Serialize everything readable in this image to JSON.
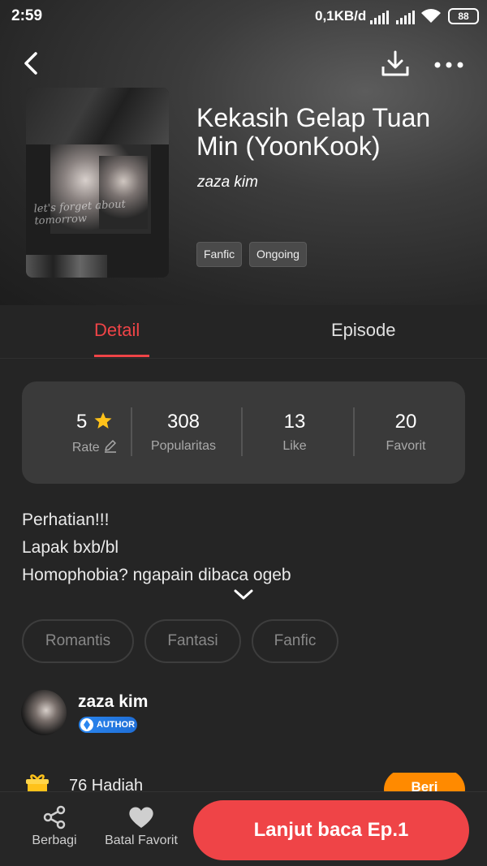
{
  "status_bar": {
    "time": "2:59",
    "network_speed": "0,1KB/d",
    "battery": "88"
  },
  "story": {
    "title": "Kekasih Gelap Tuan Min (YoonKook)",
    "author": "zaza kim",
    "cover_script": "let's forget about tomorrow",
    "tags": [
      "Fanfic",
      "Ongoing"
    ]
  },
  "tabs": {
    "detail": "Detail",
    "episode": "Episode"
  },
  "stats": {
    "rate_value": "5",
    "rate_label": "Rate",
    "popularity_value": "308",
    "popularity_label": "Popularitas",
    "like_value": "13",
    "like_label": "Like",
    "favorite_value": "20",
    "favorite_label": "Favorit"
  },
  "description": [
    "Perhatian!!!",
    "Lapak bxb/bl",
    "Homophobia? ngapain dibaca ogeb"
  ],
  "genres": [
    "Romantis",
    "Fantasi",
    "Fanfic"
  ],
  "author_card": {
    "name": "zaza kim",
    "badge": "AUTHOR"
  },
  "gift": {
    "text": "76 Hadiah",
    "button": "Beri"
  },
  "bottom_bar": {
    "share": "Berbagi",
    "unfavorite": "Batal Favorit",
    "continue": "Lanjut baca Ep.1"
  },
  "colors": {
    "accent": "#ef4447",
    "gift_button": "#ff8a00",
    "badge": "#2a86ef",
    "star": "#ffc21a"
  }
}
